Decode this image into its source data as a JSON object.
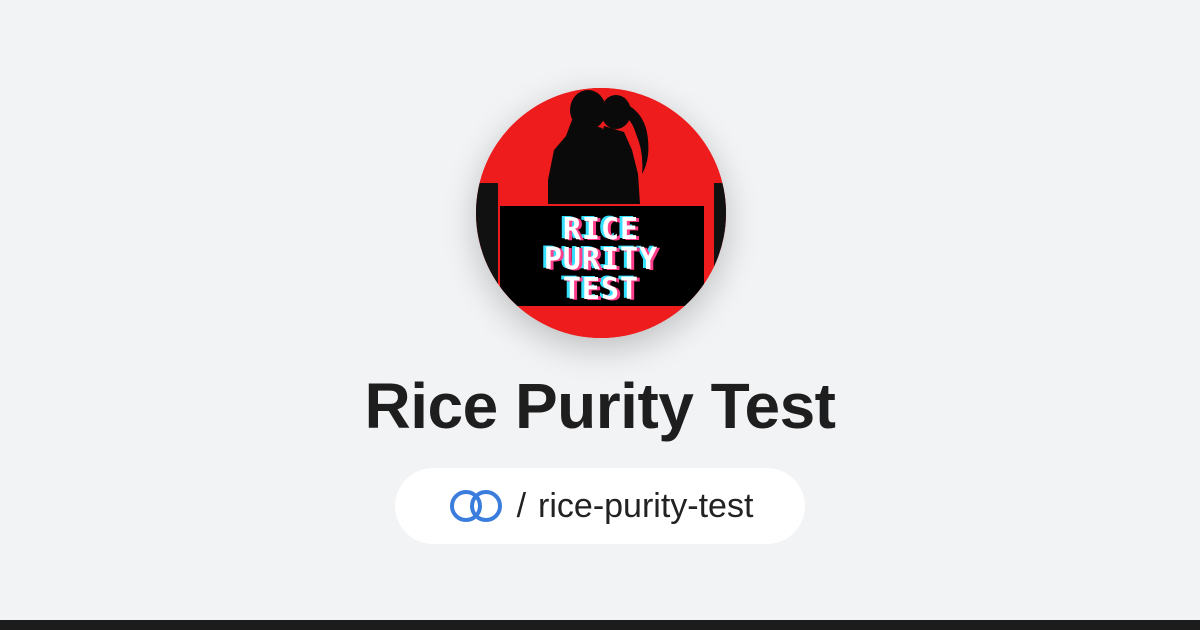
{
  "profile": {
    "avatar": {
      "logo_text_lines": [
        "RICE",
        "PURITY",
        "TEST"
      ],
      "background_color": "#ee1c1c",
      "panel_color": "#000000"
    },
    "title": "Rice Purity Test",
    "link": {
      "icon": "linked-rings-icon",
      "separator": "/",
      "slug": "rice-purity-test",
      "icon_color": "#3b7ddd"
    }
  },
  "colors": {
    "background": "#f2f3f5",
    "title_text": "#1e1e1e",
    "pill_background": "#ffffff",
    "bottom_bar": "#1c1c1c"
  }
}
